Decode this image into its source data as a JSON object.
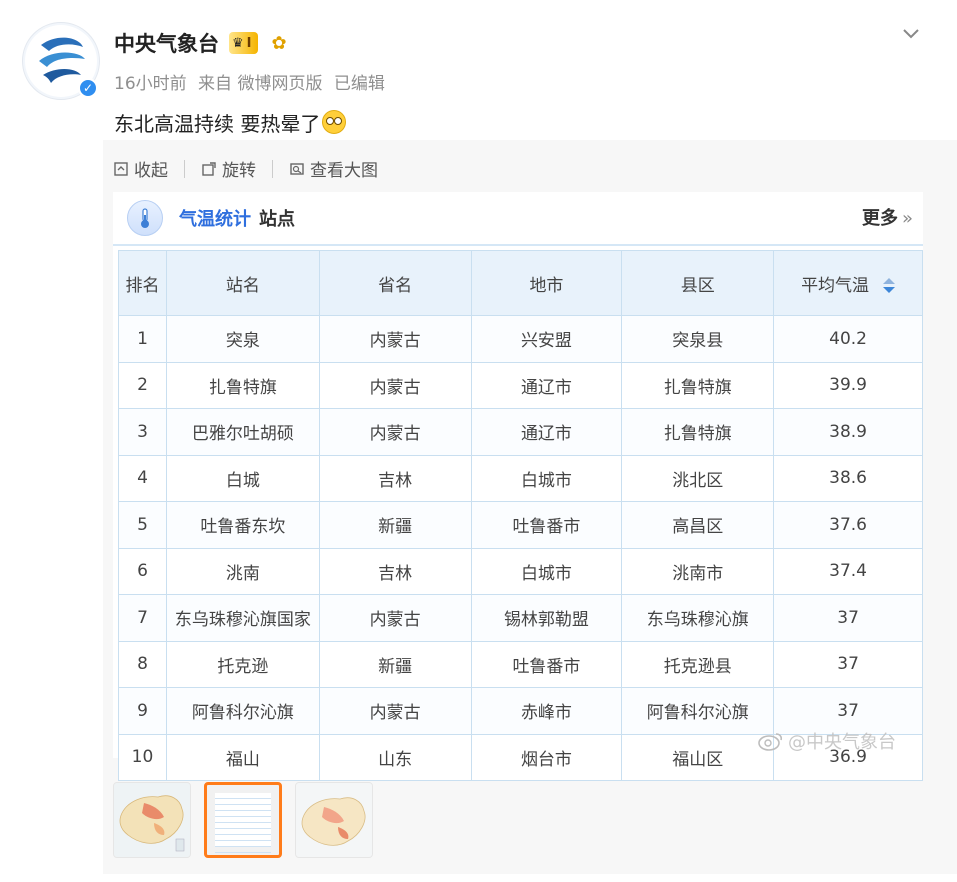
{
  "post": {
    "username": "中央气象台",
    "vip_level": "I",
    "time": "16小时前",
    "source": "来自 微博网页版",
    "edited": "已编辑",
    "text": "东北高温持续 要热晕了"
  },
  "toolbar": {
    "collapse": "收起",
    "rotate": "旋转",
    "view_large": "查看大图"
  },
  "card": {
    "title": "气温统计",
    "subtitle": "站点",
    "more": "更多",
    "columns": [
      "排名",
      "站名",
      "省名",
      "地市",
      "县区",
      "平均气温"
    ],
    "rows": [
      [
        "1",
        "突泉",
        "内蒙古",
        "兴安盟",
        "突泉县",
        "40.2"
      ],
      [
        "2",
        "扎鲁特旗",
        "内蒙古",
        "通辽市",
        "扎鲁特旗",
        "39.9"
      ],
      [
        "3",
        "巴雅尔吐胡硕",
        "内蒙古",
        "通辽市",
        "扎鲁特旗",
        "38.9"
      ],
      [
        "4",
        "白城",
        "吉林",
        "白城市",
        "洮北区",
        "38.6"
      ],
      [
        "5",
        "吐鲁番东坎",
        "新疆",
        "吐鲁番市",
        "高昌区",
        "37.6"
      ],
      [
        "6",
        "洮南",
        "吉林",
        "白城市",
        "洮南市",
        "37.4"
      ],
      [
        "7",
        "东乌珠穆沁旗国家",
        "内蒙古",
        "锡林郭勒盟",
        "东乌珠穆沁旗",
        "37"
      ],
      [
        "8",
        "托克逊",
        "新疆",
        "吐鲁番市",
        "托克逊县",
        "37"
      ],
      [
        "9",
        "阿鲁科尔沁旗",
        "内蒙古",
        "赤峰市",
        "阿鲁科尔沁旗",
        "37"
      ],
      [
        "10",
        "福山",
        "山东",
        "烟台市",
        "福山区",
        "36.9"
      ]
    ],
    "watermark": "@中央气象台"
  },
  "colors": {
    "accent": "#2f6fde",
    "active_thumb": "#ff7c1a",
    "header_bg": "#e8f2fb"
  }
}
